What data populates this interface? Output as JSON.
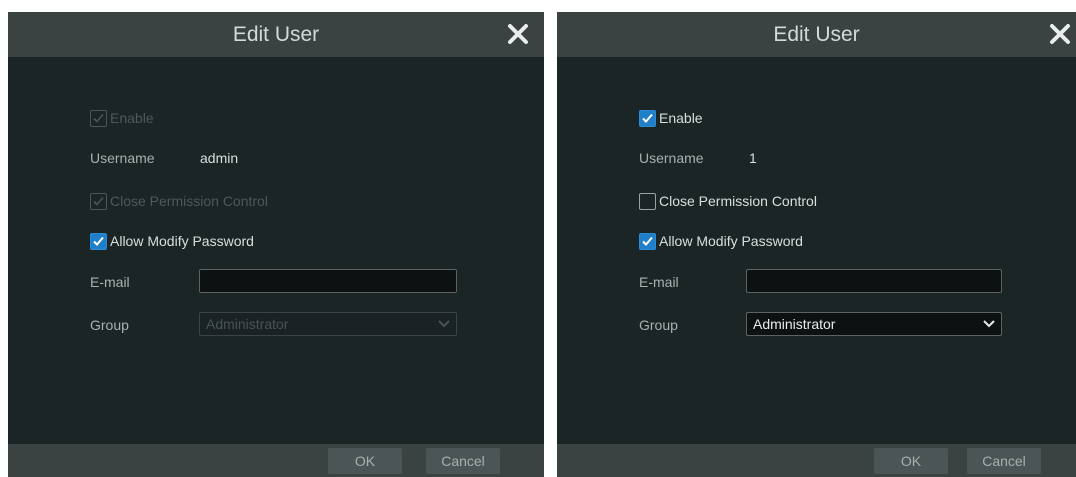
{
  "dialogs": {
    "left": {
      "title": "Edit User",
      "enable_label": "Enable",
      "username_label": "Username",
      "username_value": "admin",
      "close_permission_label": "Close Permission Control",
      "allow_modify_label": "Allow Modify Password",
      "email_label": "E-mail",
      "email_value": "",
      "group_label": "Group",
      "group_value": "Administrator",
      "ok_label": "OK",
      "cancel_label": "Cancel",
      "state": {
        "enable": "checked-disabled",
        "close_permission": "checked-disabled",
        "allow_modify": "checked",
        "group_select": "disabled"
      }
    },
    "right": {
      "title": "Edit User",
      "enable_label": "Enable",
      "username_label": "Username",
      "username_value": "1",
      "close_permission_label": "Close Permission Control",
      "allow_modify_label": "Allow Modify Password",
      "email_label": "E-mail",
      "email_value": "",
      "group_label": "Group",
      "group_value": "Administrator",
      "ok_label": "OK",
      "cancel_label": "Cancel",
      "state": {
        "enable": "checked",
        "close_permission": "unchecked",
        "allow_modify": "checked",
        "group_select": "enabled"
      }
    }
  },
  "colors": {
    "dialog_bg": "#1c2526",
    "titlebar_bg": "#3a4342",
    "checkbox_accent": "#1f7fc8",
    "button_bg": "#4c5556"
  },
  "icons": {
    "close": "close-icon",
    "check": "check-icon",
    "dropdown": "chevron-down-icon"
  }
}
